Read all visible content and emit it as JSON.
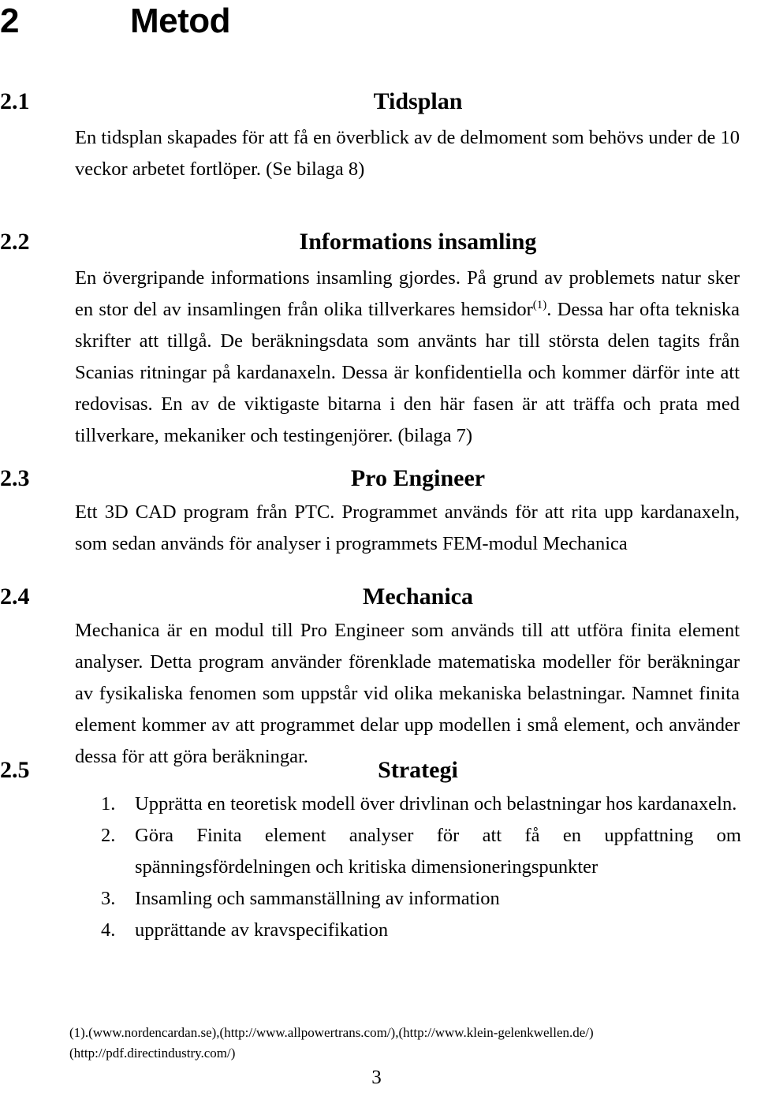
{
  "document": {
    "chapter": {
      "number": "2",
      "title": "Metod"
    },
    "sections": [
      {
        "number": "2.1",
        "title": "Tidsplan",
        "body": "En tidsplan skapades för att få en överblick av de delmoment som behövs under de 10 veckor arbetet fortlöper. (Se bilaga 8)"
      },
      {
        "number": "2.2",
        "title": "Informations insamling",
        "body_part1": "En övergripande informations insamling gjordes. På grund av problemets natur sker en stor del av insamlingen från olika tillverkares hemsidor",
        "footnote_marker": "(1)",
        "body_part2": ". Dessa har ofta tekniska skrifter att tillgå. De beräkningsdata som använts har till största delen tagits från Scanias ritningar på kardanaxeln. Dessa är konfidentiella och kommer därför inte att redovisas. En av de viktigaste bitarna i den här fasen är att träffa och prata med tillverkare, mekaniker och testingenjörer. (bilaga 7)"
      },
      {
        "number": "2.3",
        "title": "Pro Engineer",
        "body": "Ett 3D CAD program från PTC. Programmet används för att rita upp kardanaxeln, som sedan används för analyser i programmets FEM-modul Mechanica"
      },
      {
        "number": "2.4",
        "title": "Mechanica",
        "body": "Mechanica är en modul till Pro Engineer som används till att utföra finita element analyser. Detta program använder förenklade matematiska modeller för beräkningar av fysikaliska fenomen som uppstår vid olika mekaniska belastningar. Namnet finita element kommer av att programmet delar upp modellen i små element, och använder dessa för att göra beräkningar."
      },
      {
        "number": "2.5",
        "title": "Strategi",
        "list": [
          {
            "marker": "1.",
            "text": "Upprätta en teoretisk modell över drivlinan och belastningar hos kardanaxeln."
          },
          {
            "marker": "2.",
            "text": "Göra Finita element analyser för att få en uppfattning om spänningsfördelningen och kritiska dimensioneringspunkter"
          },
          {
            "marker": "3.",
            "text": "Insamling och sammanställning av information"
          },
          {
            "marker": "4.",
            "text": "upprättande av kravspecifikation"
          }
        ]
      }
    ],
    "footnote": {
      "line1": "(1).(www.nordencardan.se),(http://www.allpowertrans.com/),(http://www.klein-gelenkwellen.de/)",
      "line2": "(http://pdf.directindustry.com/)"
    },
    "page_number": "3"
  }
}
